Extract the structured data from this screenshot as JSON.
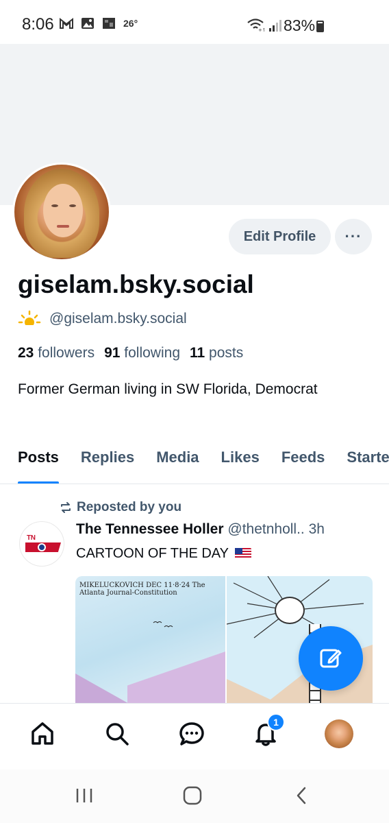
{
  "status_bar": {
    "time": "8:06",
    "temperature": "26°",
    "battery": "83%",
    "battery_level": 0.83,
    "icons": [
      "gmail-icon",
      "gallery-icon",
      "weather-app-icon",
      "wifi-icon",
      "signal-icon",
      "battery-icon"
    ]
  },
  "profile": {
    "display_name": "giselam.bsky.social",
    "handle": "@giselam.bsky.social",
    "edit_button": "Edit Profile",
    "more_button": "···",
    "followers_count": "23",
    "followers_label": "followers",
    "following_count": "91",
    "following_label": "following",
    "posts_count": "11",
    "posts_label": "posts",
    "bio": "Former German living in SW Florida, Democrat"
  },
  "tabs": [
    {
      "label": "Posts",
      "active": true
    },
    {
      "label": "Replies",
      "active": false
    },
    {
      "label": "Media",
      "active": false
    },
    {
      "label": "Likes",
      "active": false
    },
    {
      "label": "Feeds",
      "active": false
    },
    {
      "label": "Starter Packs",
      "active": false
    }
  ],
  "post": {
    "repost_label": "Reposted by you",
    "author_name": "The Tennessee Holler",
    "author_handle": "@thetnholl..",
    "time": "3h",
    "avatar_text": "TN HOLLER",
    "text": "CARTOON OF THE DAY",
    "image_signature": "MIKELUCKOVICH DEC 11·8·24 The Atlanta Journal-Constitution"
  },
  "bottom_nav": {
    "items": [
      "home-icon",
      "search-icon",
      "chat-icon",
      "bell-icon",
      "profile-avatar"
    ],
    "notification_badge": "1"
  },
  "colors": {
    "accent": "#1083fe",
    "text_primary": "#0b0f14",
    "text_secondary": "#42576c",
    "button_bg": "#eef1f4",
    "banner": "#f1f3f5"
  }
}
